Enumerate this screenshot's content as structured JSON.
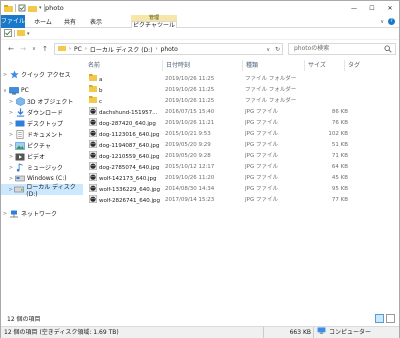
{
  "window": {
    "title": "photo",
    "minimize": "—",
    "maximize": "☐",
    "close": "✕"
  },
  "ribbon": {
    "context_group": "管理",
    "tabs": [
      "ファイル",
      "ホーム",
      "共有",
      "表示",
      "ピクチャツール"
    ],
    "help": "?"
  },
  "address": {
    "back": "←",
    "forward": "→",
    "dropdown": "∨",
    "up": "↑",
    "crumbs": [
      "PC",
      "ローカル ディスク (D:)",
      "photo"
    ],
    "refresh": "↻"
  },
  "search": {
    "placeholder": "photoの検索"
  },
  "nav": {
    "items": [
      {
        "label": "クイック アクセス",
        "icon": "star-icon",
        "expander": ">"
      },
      {
        "label": "PC",
        "icon": "computer-icon",
        "expander": "∨"
      },
      {
        "label": "3D オブジェクト",
        "icon": "cube-icon",
        "expander": ">"
      },
      {
        "label": "ダウンロード",
        "icon": "download-icon",
        "expander": ">"
      },
      {
        "label": "デスクトップ",
        "icon": "desktop-icon",
        "expander": ">"
      },
      {
        "label": "ドキュメント",
        "icon": "document-icon",
        "expander": ">"
      },
      {
        "label": "ピクチャ",
        "icon": "picture-icon",
        "expander": ">"
      },
      {
        "label": "ビデオ",
        "icon": "video-icon",
        "expander": ">"
      },
      {
        "label": "ミュージック",
        "icon": "music-icon",
        "expander": ">"
      },
      {
        "label": "Windows (C:)",
        "icon": "drive-icon",
        "expander": ">"
      },
      {
        "label": "ローカル ディスク (D:)",
        "icon": "drive-icon",
        "expander": ">"
      },
      {
        "label": "ネットワーク",
        "icon": "network-icon",
        "expander": ">"
      }
    ]
  },
  "columns": {
    "name": "名前",
    "date": "日付時刻",
    "type": "種類",
    "size": "サイズ",
    "tag": "タグ"
  },
  "files": [
    {
      "name": "a",
      "date": "2019/10/26 11:25",
      "type": "ファイル フォルダー",
      "size": "",
      "kind": "folder"
    },
    {
      "name": "b",
      "date": "2019/10/26 11:25",
      "type": "ファイル フォルダー",
      "size": "",
      "kind": "folder"
    },
    {
      "name": "c",
      "date": "2019/10/26 11:25",
      "type": "ファイル フォルダー",
      "size": "",
      "kind": "folder"
    },
    {
      "name": "dachshund-151957...",
      "date": "2016/07/15 15:40",
      "type": "JPG ファイル",
      "size": "86 KB",
      "kind": "image"
    },
    {
      "name": "dog-287420_640.jpg",
      "date": "2019/10/26 11:21",
      "type": "JPG ファイル",
      "size": "76 KB",
      "kind": "image"
    },
    {
      "name": "dog-1123016_640.jpg",
      "date": "2015/10/21 9:53",
      "type": "JPG ファイル",
      "size": "102 KB",
      "kind": "image"
    },
    {
      "name": "dog-1194087_640.jpg",
      "date": "2019/05/20 9:29",
      "type": "JPG ファイル",
      "size": "51 KB",
      "kind": "image"
    },
    {
      "name": "dog-1210559_640.jpg",
      "date": "2019/05/20 9:28",
      "type": "JPG ファイル",
      "size": "71 KB",
      "kind": "image"
    },
    {
      "name": "dog-2785074_640.jpg",
      "date": "2015/10/12 12:17",
      "type": "JPG ファイル",
      "size": "64 KB",
      "kind": "image"
    },
    {
      "name": "wolf-142173_640.jpg",
      "date": "2019/10/26 11:20",
      "type": "JPG ファイル",
      "size": "45 KB",
      "kind": "image"
    },
    {
      "name": "wolf-1336229_640.jpg",
      "date": "2014/08/30 14:34",
      "type": "JPG ファイル",
      "size": "95 KB",
      "kind": "image"
    },
    {
      "name": "wolf-2826741_640.jpg",
      "date": "2017/09/14 15:23",
      "type": "JPG ファイル",
      "size": "77 KB",
      "kind": "image"
    }
  ],
  "status": {
    "count": "12 個の項目",
    "bottom_left": "12 個の項目 (空きディスク領域: 1.69 TB)",
    "bottom_size": "663 KB",
    "bottom_location": "コンピューター"
  },
  "colors": {
    "accent": "#1979ca",
    "selection": "#cce8ff",
    "folder": "#f0c94d",
    "context_tab": "#f7e6a8"
  }
}
